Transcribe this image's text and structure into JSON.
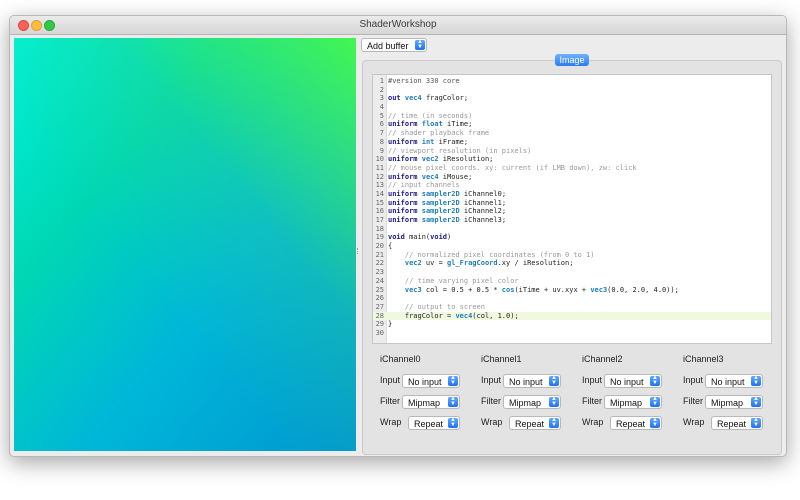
{
  "window": {
    "title": "ShaderWorkshop"
  },
  "toolbar": {
    "add_buffer_label": "Add buffer"
  },
  "tabs": [
    {
      "label": "Image",
      "selected": true
    }
  ],
  "editor": {
    "active_line": 28,
    "lines": [
      "#version 330 core",
      "",
      "out vec4 fragColor;",
      "",
      "// time (in seconds)",
      "uniform float iTime;",
      "// shader playback frame",
      "uniform int iFrame;",
      "// viewport resolution (in pixels)",
      "uniform vec2 iResolution;",
      "// mouse pixel coords. xy: current (if LMB down), zw: click",
      "uniform vec4 iMouse;",
      "// input channels",
      "uniform sampler2D iChannel0;",
      "uniform sampler2D iChannel1;",
      "uniform sampler2D iChannel2;",
      "uniform sampler2D iChannel3;",
      "",
      "void main(void)",
      "{",
      "    // normalized pixel coordinates (from 0 to 1)",
      "    vec2 uv = gl_FragCoord.xy / iResolution;",
      "",
      "    // time varying pixel color",
      "    vec3 col = 0.5 + 0.5 * cos(iTime + uv.xyx + vec3(0.0, 2.0, 4.0));",
      "",
      "    // output to screen",
      "    fragColor = vec4(col, 1.0);",
      "}",
      ""
    ]
  },
  "channels": [
    {
      "title": "iChannel0",
      "input_label": "Input",
      "input_value": "No input",
      "filter_label": "Filter",
      "filter_value": "Mipmap",
      "wrap_label": "Wrap",
      "wrap_value": "Repeat"
    },
    {
      "title": "iChannel1",
      "input_label": "Input",
      "input_value": "No input",
      "filter_label": "Filter",
      "filter_value": "Mipmap",
      "wrap_label": "Wrap",
      "wrap_value": "Repeat"
    },
    {
      "title": "iChannel2",
      "input_label": "Input",
      "input_value": "No input",
      "filter_label": "Filter",
      "filter_value": "Mipmap",
      "wrap_label": "Wrap",
      "wrap_value": "Repeat"
    },
    {
      "title": "iChannel3",
      "input_label": "Input",
      "input_value": "No input",
      "filter_label": "Filter",
      "filter_value": "Mipmap",
      "wrap_label": "Wrap",
      "wrap_value": "Repeat"
    }
  ],
  "icons": {
    "close": "close-icon",
    "minimize": "minimize-icon",
    "maximize": "maximize-icon",
    "select_arrows": "chevron-updown-icon"
  },
  "colors": {
    "accent": "#2a7cf3",
    "active_line": "#eef9df",
    "close": "#fc605b",
    "minimize": "#fdbc40",
    "maximize": "#34c84a"
  }
}
